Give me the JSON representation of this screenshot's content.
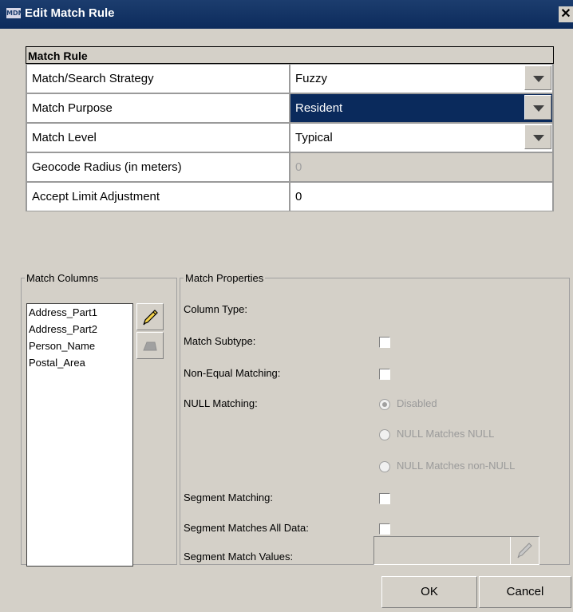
{
  "window": {
    "title": "Edit Match Rule",
    "icon_text": "MDM"
  },
  "rule": {
    "header": "Match Rule",
    "rows": [
      {
        "label": "Match/Search Strategy",
        "value": "Fuzzy",
        "type": "dropdown"
      },
      {
        "label": "Match Purpose",
        "value": "Resident",
        "type": "dropdown",
        "selected": true
      },
      {
        "label": "Match Level",
        "value": "Typical",
        "type": "dropdown"
      },
      {
        "label": "Geocode Radius (in meters)",
        "value": "0",
        "type": "disabled"
      },
      {
        "label": "Accept Limit Adjustment",
        "value": "0",
        "type": "text"
      }
    ]
  },
  "match_columns": {
    "legend": "Match Columns",
    "items": [
      "Address_Part1",
      "Address_Part2",
      "Person_Name",
      "Postal_Area"
    ],
    "edit_icon": "pencil-icon",
    "delete_icon": "eraser-icon"
  },
  "match_properties": {
    "legend": "Match Properties",
    "column_type_label": "Column Type:",
    "match_subtype_label": "Match Subtype:",
    "non_equal_label": "Non-Equal Matching:",
    "null_matching_label": "NULL Matching:",
    "null_options": [
      "Disabled",
      "NULL Matches NULL",
      "NULL Matches non-NULL"
    ],
    "null_selected": "Disabled",
    "segment_matching_label": "Segment Matching:",
    "segment_all_label": "Segment Matches All Data:",
    "segment_values_label": "Segment Match Values:"
  },
  "buttons": {
    "ok": "OK",
    "cancel": "Cancel"
  },
  "colors": {
    "title_bar": "#0c2b5c",
    "selected_row": "#0a2a5c",
    "dialog_bg": "#d4d0c8"
  }
}
